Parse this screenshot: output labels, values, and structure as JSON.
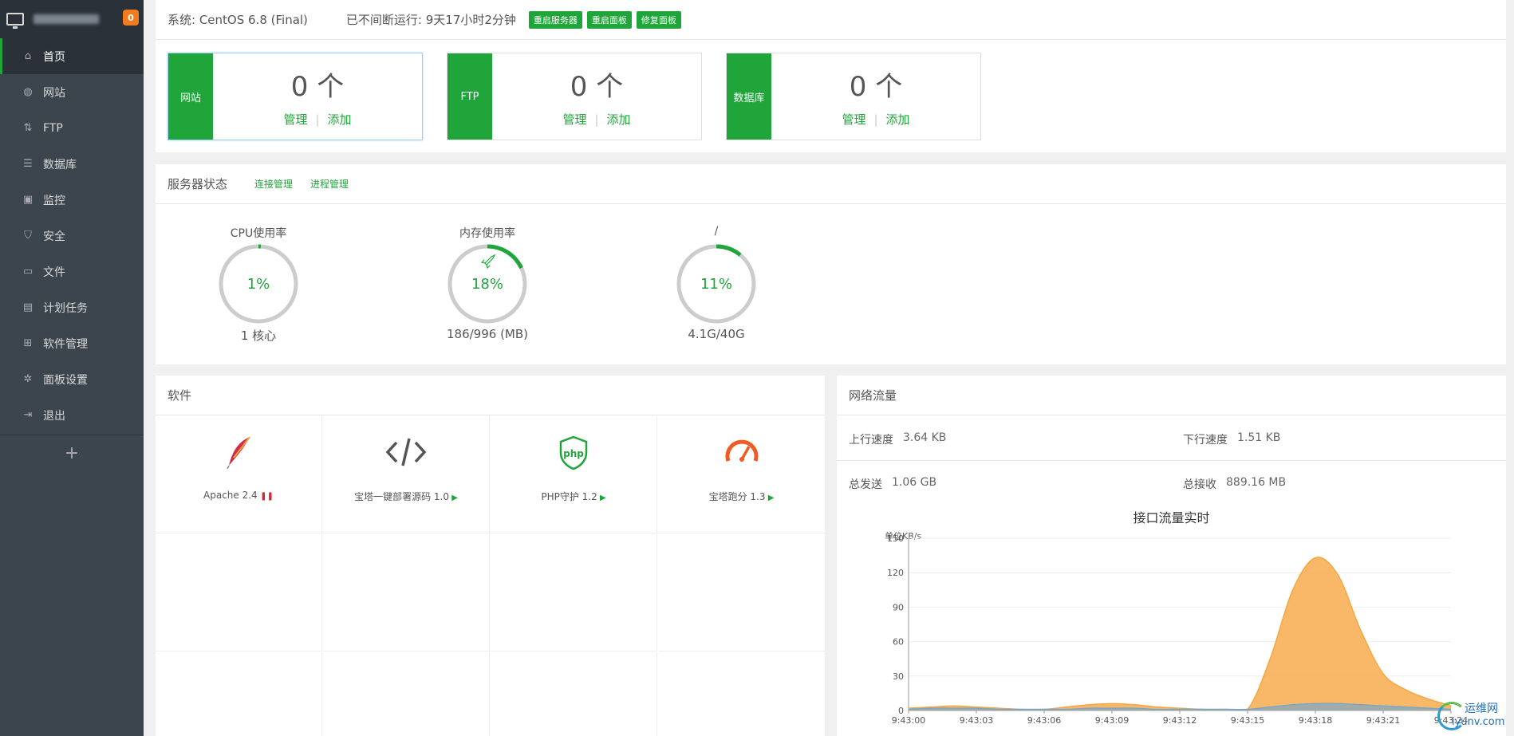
{
  "brand": {
    "badge": "0"
  },
  "nav": [
    {
      "label": "首页",
      "icon": "home-icon",
      "active": true
    },
    {
      "label": "网站",
      "icon": "globe-icon"
    },
    {
      "label": "FTP",
      "icon": "ftp-icon"
    },
    {
      "label": "数据库",
      "icon": "database-icon"
    },
    {
      "label": "监控",
      "icon": "monitor-icon"
    },
    {
      "label": "安全",
      "icon": "shield-icon"
    },
    {
      "label": "文件",
      "icon": "folder-icon"
    },
    {
      "label": "计划任务",
      "icon": "calendar-icon"
    },
    {
      "label": "软件管理",
      "icon": "grid-icon"
    },
    {
      "label": "面板设置",
      "icon": "gear-icon"
    },
    {
      "label": "退出",
      "icon": "logout-icon"
    }
  ],
  "topbar": {
    "system": "系统: CentOS 6.8 (Final)",
    "uptime": "已不间断运行: 9天17小时2分钟",
    "restart_server": "重启服务器",
    "restart_panel": "重启面板",
    "repair_panel": "修复面板"
  },
  "stats": [
    {
      "tag": "网站",
      "count": "0 个",
      "manage": "管理",
      "add": "添加"
    },
    {
      "tag": "FTP",
      "count": "0 个",
      "manage": "管理",
      "add": "添加"
    },
    {
      "tag": "数据库",
      "count": "0 个",
      "manage": "管理",
      "add": "添加"
    }
  ],
  "server_status": {
    "title": "服务器状态",
    "link_conn": "连接管理",
    "link_proc": "进程管理",
    "gauges": [
      {
        "label": "CPU使用率",
        "value": "1%",
        "percent": 1,
        "sub": "1 核心"
      },
      {
        "label": "内存使用率",
        "value": "18%",
        "percent": 18,
        "sub": "186/996 (MB)"
      },
      {
        "label": "/",
        "value": "11%",
        "percent": 11,
        "sub": "4.1G/40G"
      }
    ]
  },
  "software": {
    "title": "软件",
    "items": [
      {
        "name": "Apache 2.4",
        "icon": "apache-feather-icon",
        "status": "paused"
      },
      {
        "name": "宝塔一键部署源码 1.0",
        "icon": "code-icon",
        "status": "play"
      },
      {
        "name": "PHP守护 1.2",
        "icon": "php-shield-icon",
        "status": "play"
      },
      {
        "name": "宝塔跑分 1.3",
        "icon": "speedometer-icon",
        "status": "play"
      }
    ]
  },
  "network": {
    "title": "网络流量",
    "up_label": "上行速度",
    "up_value": "3.64 KB",
    "down_label": "下行速度",
    "down_value": "1.51 KB",
    "sent_label": "总发送",
    "sent_value": "1.06 GB",
    "recv_label": "总接收",
    "recv_value": "889.16 MB"
  },
  "chart_data": {
    "type": "area",
    "title": "接口流量实时",
    "ylabel": "单位KB/s",
    "ylim": [
      0,
      150
    ],
    "yticks": [
      0,
      30,
      60,
      90,
      120,
      150
    ],
    "x": [
      "9:43:00",
      "9:43:01",
      "9:43:02",
      "9:43:03",
      "9:43:04",
      "9:43:05",
      "9:43:06",
      "9:43:07",
      "9:43:08",
      "9:43:09",
      "9:43:10",
      "9:43:11",
      "9:43:12",
      "9:43:13",
      "9:43:14",
      "9:43:15",
      "9:43:16",
      "9:43:17",
      "9:43:18",
      "9:43:19",
      "9:43:20",
      "9:43:21",
      "9:43:22",
      "9:43:23",
      "9:43:24"
    ],
    "xtick_labels": [
      "9:43:00",
      "9:43:03",
      "9:43:06",
      "9:43:09",
      "9:43:12",
      "9:43:15",
      "9:43:18",
      "9:43:21",
      "9:43:24"
    ],
    "series": [
      {
        "color": "#f7a642",
        "values": [
          2,
          3,
          4,
          3,
          2,
          1,
          1,
          3,
          5,
          6,
          5,
          3,
          2,
          1,
          1,
          1,
          45,
          105,
          133,
          118,
          70,
          32,
          18,
          10,
          4
        ]
      },
      {
        "color": "#7aa7c7",
        "values": [
          1,
          2,
          2,
          2,
          1,
          1,
          1,
          1,
          2,
          2,
          2,
          1,
          1,
          1,
          1,
          1,
          3,
          5,
          6,
          6,
          5,
          4,
          3,
          2,
          1
        ]
      }
    ]
  },
  "watermark": {
    "line1": "运维网",
    "line2": "iyunv.com"
  },
  "colors": {
    "accent": "#20a53a",
    "sidebar": "#3c444d",
    "area_main": "#f7a642",
    "area_secondary": "#7aa7c7"
  }
}
